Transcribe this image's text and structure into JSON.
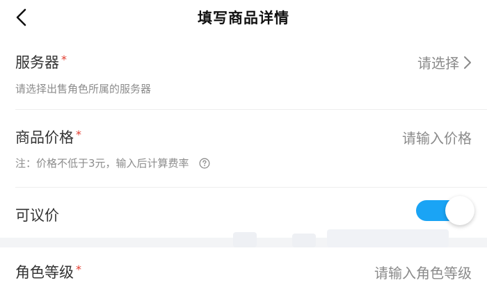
{
  "header": {
    "title": "填写商品详情",
    "back_icon": "chevron-left-icon"
  },
  "fields": {
    "server": {
      "label": "服务器",
      "required_mark": "*",
      "value": "请选择",
      "hint": "请选择出售角色所属的服务器",
      "icon": "chevron-right-icon"
    },
    "price": {
      "label": "商品价格",
      "required_mark": "*",
      "placeholder": "请输入价格",
      "hint": "注：价格不低于3元，输入后计算费率",
      "help_icon": "question-circle-icon"
    },
    "negotiable": {
      "label": "可议价",
      "toggle_on": true,
      "accent_color": "#1aa4f5"
    },
    "role_level": {
      "label": "角色等级",
      "required_mark": "*",
      "placeholder": "请输入角色等级"
    }
  },
  "colors": {
    "required": "#e23b2e",
    "background": "#ffffff",
    "band": "#f3f4f6"
  }
}
